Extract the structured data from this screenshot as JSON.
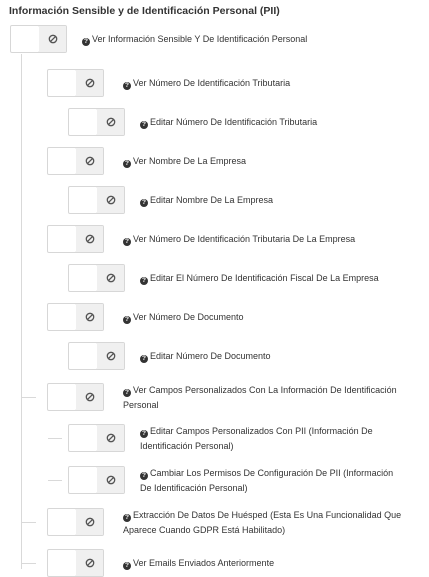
{
  "section_title": "Información Sensible y de Identificación Personal (PII)",
  "permissions": [
    {
      "label": "Ver Información Sensible Y De Identificación Personal"
    },
    {
      "label": "Ver Número De Identificación Tributaria"
    },
    {
      "label": "Editar Número De Identificación Tributaria"
    },
    {
      "label": "Ver Nombre De La Empresa"
    },
    {
      "label": "Editar Nombre De La Empresa"
    },
    {
      "label": "Ver Número De Identificación Tributaria De La Empresa"
    },
    {
      "label": "Editar El Número De Identificación Fiscal De La Empresa"
    },
    {
      "label": "Ver Número De Documento"
    },
    {
      "label": "Editar Número De Documento"
    },
    {
      "label": "Ver Campos Personalizados Con La Información De Identificación Personal"
    },
    {
      "label": "Editar Campos Personalizados Con PII (Información De Identificación Personal)"
    },
    {
      "label": "Cambiar Los Permisos De Configuración De PII (Información De Identificación Personal)"
    },
    {
      "label": "Extracción De Datos De Huésped (Esta Es Una Funcionalidad Que Aparece Cuando GDPR Está Habilitado)"
    },
    {
      "label": "Ver Emails Enviados Anteriormente"
    }
  ],
  "icons": {
    "off_state": "ban-icon",
    "help": "question-circle-icon"
  }
}
